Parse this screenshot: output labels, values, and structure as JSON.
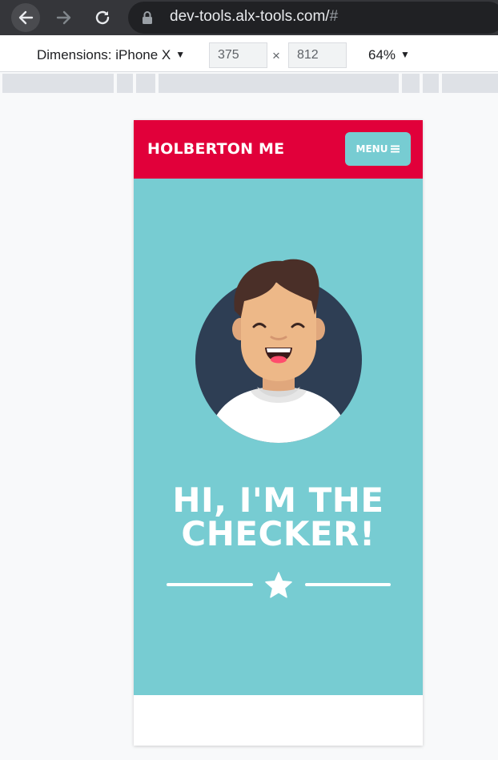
{
  "browser": {
    "url_main": "dev-tools.alx-tools.com/",
    "url_hash": "#",
    "icons": [
      "back-arrow-icon",
      "forward-arrow-icon",
      "reload-icon",
      "lock-icon"
    ]
  },
  "devtools": {
    "dimensions_label": "Dimensions: iPhone X",
    "width_value": "375",
    "height_value": "812",
    "times_symbol": "×",
    "zoom_label": "64%",
    "dropdown_arrow": "▼"
  },
  "site": {
    "brand": "HOLBERTON ME",
    "menu_label": "MENU",
    "menu_icon": "hamburger-icon",
    "hero_title_line1": "HI, I'M THE",
    "hero_title_line2": "CHECKER!",
    "divider_icon": "star-icon"
  },
  "colors": {
    "header_red": "#e1003a",
    "hero_teal": "#77ccd2",
    "avatar_navy": "#2e3e54",
    "browser_dark": "#35363a"
  }
}
